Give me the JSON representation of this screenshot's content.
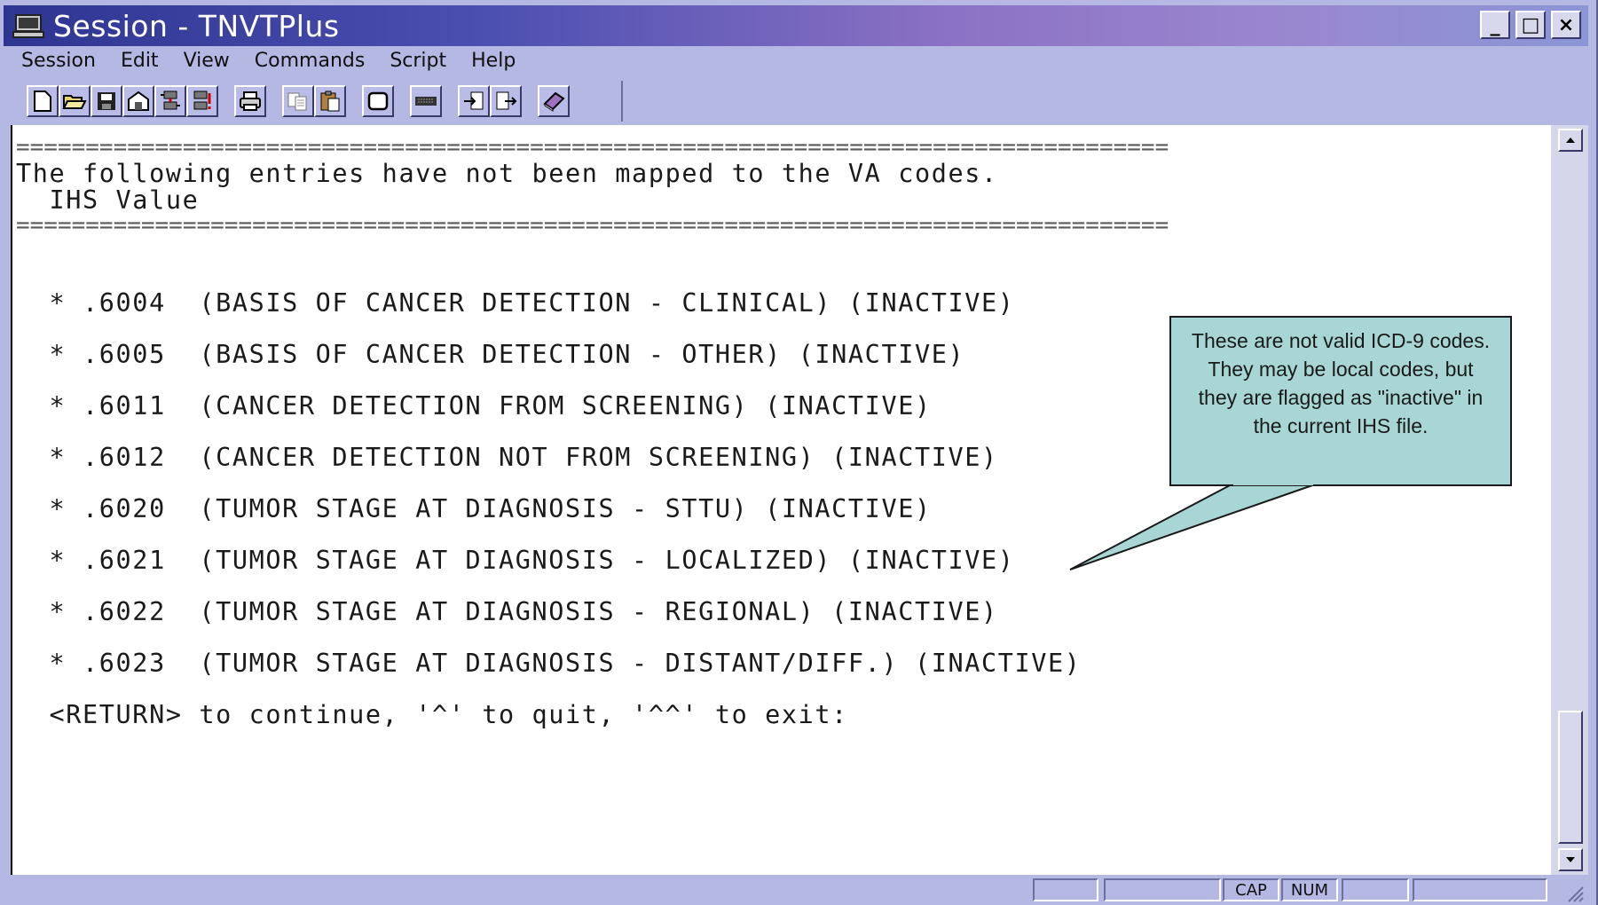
{
  "window": {
    "title": "Session - TNVTPlus",
    "controls": {
      "minimize": "_",
      "maximize": "□",
      "close": "×"
    }
  },
  "menu": {
    "items": [
      "Session",
      "Edit",
      "View",
      "Commands",
      "Script",
      "Help"
    ]
  },
  "toolbar": {
    "icons": [
      "new-session-icon",
      "open-icon",
      "save-icon",
      "properties-icon",
      "connect-icon",
      "disconnect-icon",
      "print-icon",
      "copy-icon",
      "paste-icon",
      "window-icon",
      "keyboard-icon",
      "receive-file-icon",
      "send-file-icon",
      "help-book-icon"
    ]
  },
  "terminal": {
    "separator": "===================================================================================",
    "header_line": "The following entries have not been mapped to the VA codes.",
    "column_header": "  IHS Value",
    "entries": [
      "  * .6004  (BASIS OF CANCER DETECTION - CLINICAL) (INACTIVE)",
      "  * .6005  (BASIS OF CANCER DETECTION - OTHER) (INACTIVE)",
      "  * .6011  (CANCER DETECTION FROM SCREENING) (INACTIVE)",
      "  * .6012  (CANCER DETECTION NOT FROM SCREENING) (INACTIVE)",
      "  * .6020  (TUMOR STAGE AT DIAGNOSIS - STTU) (INACTIVE)",
      "  * .6021  (TUMOR STAGE AT DIAGNOSIS - LOCALIZED) (INACTIVE)",
      "  * .6022  (TUMOR STAGE AT DIAGNOSIS - REGIONAL) (INACTIVE)",
      "  * .6023  (TUMOR STAGE AT DIAGNOSIS - DISTANT/DIFF.) (INACTIVE)"
    ],
    "prompt": "  <RETURN> to continue, '^' to quit, '^^' to exit:"
  },
  "callout": {
    "text": "These are not valid ICD-9 codes. They may be local codes, but they are flagged as \"inactive\" in the current IHS file."
  },
  "statusbar": {
    "cap": "CAP",
    "num": "NUM"
  },
  "colors": {
    "title_gradient_start": "#2e3591",
    "title_gradient_end": "#9a86d0",
    "chrome": "#b4b8e2",
    "callout_fill": "#a8d6d4"
  }
}
